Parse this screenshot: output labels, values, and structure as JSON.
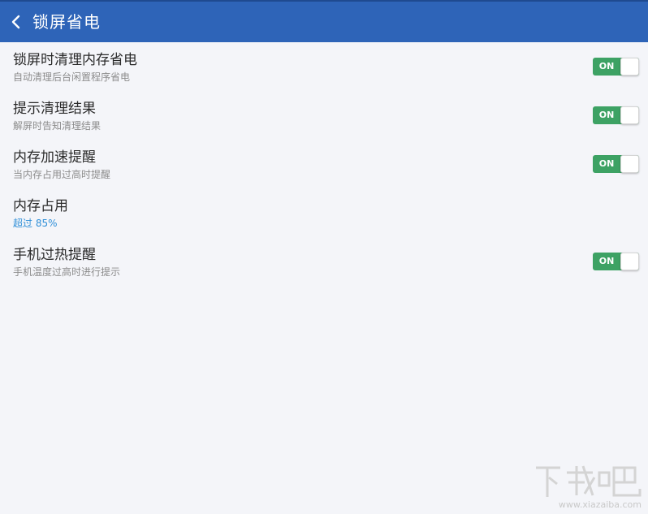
{
  "header": {
    "title": "锁屏省电",
    "back_icon": "chevron-left-icon",
    "color": "#2e64b8"
  },
  "settings": [
    {
      "title": "锁屏时清理内存省电",
      "subtitle": "自动清理后台闲置程序省电",
      "toggle": "ON",
      "checked": true
    },
    {
      "title": "提示清理结果",
      "subtitle": "解屏时告知清理结果",
      "toggle": "ON",
      "checked": true
    },
    {
      "title": "内存加速提醒",
      "subtitle": "当内存占用过高时提醒",
      "toggle": "ON",
      "checked": true
    },
    {
      "title": "内存占用",
      "subtitle": "超过 85%"
    },
    {
      "title": "手机过热提醒",
      "subtitle": "手机温度过高时进行提示",
      "toggle": "ON",
      "checked": true
    }
  ],
  "colors": {
    "toggle_on": "#3da264",
    "accent_text": "#2f8fd8",
    "background": "#f4f5f9"
  },
  "watermark": {
    "logo": "下载吧",
    "url": "www.xiazaiba.com"
  }
}
